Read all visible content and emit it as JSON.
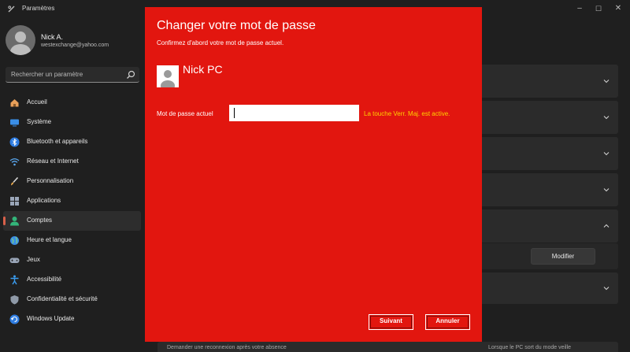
{
  "window": {
    "title": "Paramètres",
    "icons": {
      "app": "settings-app-icon",
      "minimize": "minimize-icon",
      "maximize": "maximize-icon",
      "close": "close-icon"
    }
  },
  "profile": {
    "name": "Nick A.",
    "email": "westexchange@yahoo.com"
  },
  "search": {
    "placeholder": "Rechercher un paramètre"
  },
  "sidebar": {
    "active_index": 6,
    "items": [
      {
        "label": "Accueil",
        "icon": "home-icon"
      },
      {
        "label": "Système",
        "icon": "system-icon"
      },
      {
        "label": "Bluetooth et appareils",
        "icon": "bluetooth-icon"
      },
      {
        "label": "Réseau et Internet",
        "icon": "wifi-icon"
      },
      {
        "label": "Personnalisation",
        "icon": "brush-icon"
      },
      {
        "label": "Applications",
        "icon": "apps-icon"
      },
      {
        "label": "Comptes",
        "icon": "account-icon"
      },
      {
        "label": "Heure et langue",
        "icon": "globe-icon"
      },
      {
        "label": "Jeux",
        "icon": "gamepad-icon"
      },
      {
        "label": "Accessibilité",
        "icon": "accessibility-icon"
      },
      {
        "label": "Confidentialité et sécurité",
        "icon": "shield-icon"
      },
      {
        "label": "Windows Update",
        "icon": "update-icon"
      }
    ]
  },
  "main": {
    "modify_button": "Modifier",
    "bottom_left_text": "Demander une reconnexion après votre absence",
    "bottom_right_text": "Lorsque le PC sort du mode veille"
  },
  "dialog": {
    "title": "Changer votre mot de passe",
    "subtitle": "Confirmez d'abord votre mot de passe actuel.",
    "account_name": "Nick PC",
    "password_label": "Mot de passe actuel",
    "password_value": "",
    "caps_lock_warning": "La touche Verr. Maj. est active.",
    "next_button": "Suivant",
    "cancel_button": "Annuler"
  },
  "colors": {
    "dialog_background": "#e2160f",
    "warning_text": "#ffd400",
    "window_background": "#1f1f1f",
    "card_background": "#2b2b2b",
    "active_indicator": "#d8604a"
  }
}
